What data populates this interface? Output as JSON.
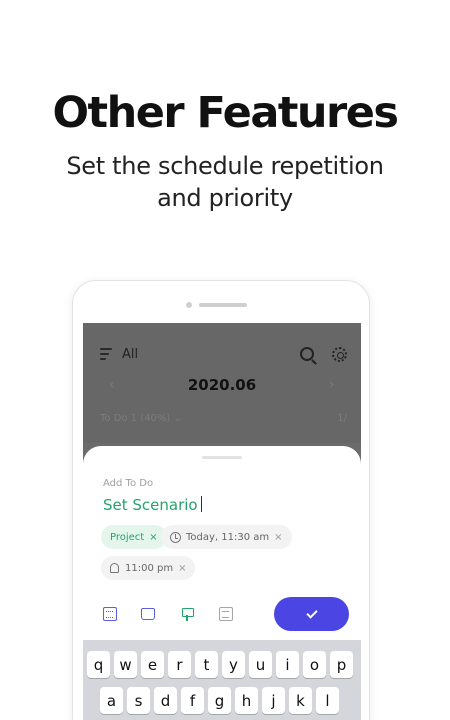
{
  "promo": {
    "title": "Other Features",
    "subtitle_line1": "Set the schedule repetition",
    "subtitle_line2": "and priority"
  },
  "app": {
    "filter_label": "All",
    "month": "2020.06",
    "prev_arrow": "‹",
    "next_arrow": "›",
    "section_label": "To Do 1 (40%) ⌄",
    "section_count": "1/"
  },
  "add_todo": {
    "title": "Add To Do",
    "task_text": "Set Scenario",
    "chips": {
      "project": "Project",
      "time": "Today, 11:30 am",
      "alarm": "11:00 pm",
      "remove": "×"
    },
    "save_icon": "check-icon",
    "colors": {
      "accent": "#4a45e3",
      "green": "#25a36d"
    }
  },
  "keyboard": {
    "row1": [
      "q",
      "w",
      "e",
      "r",
      "t",
      "y",
      "u",
      "i",
      "o",
      "p"
    ],
    "row2": [
      "a",
      "s",
      "d",
      "f",
      "g",
      "h",
      "j",
      "k",
      "l"
    ]
  }
}
